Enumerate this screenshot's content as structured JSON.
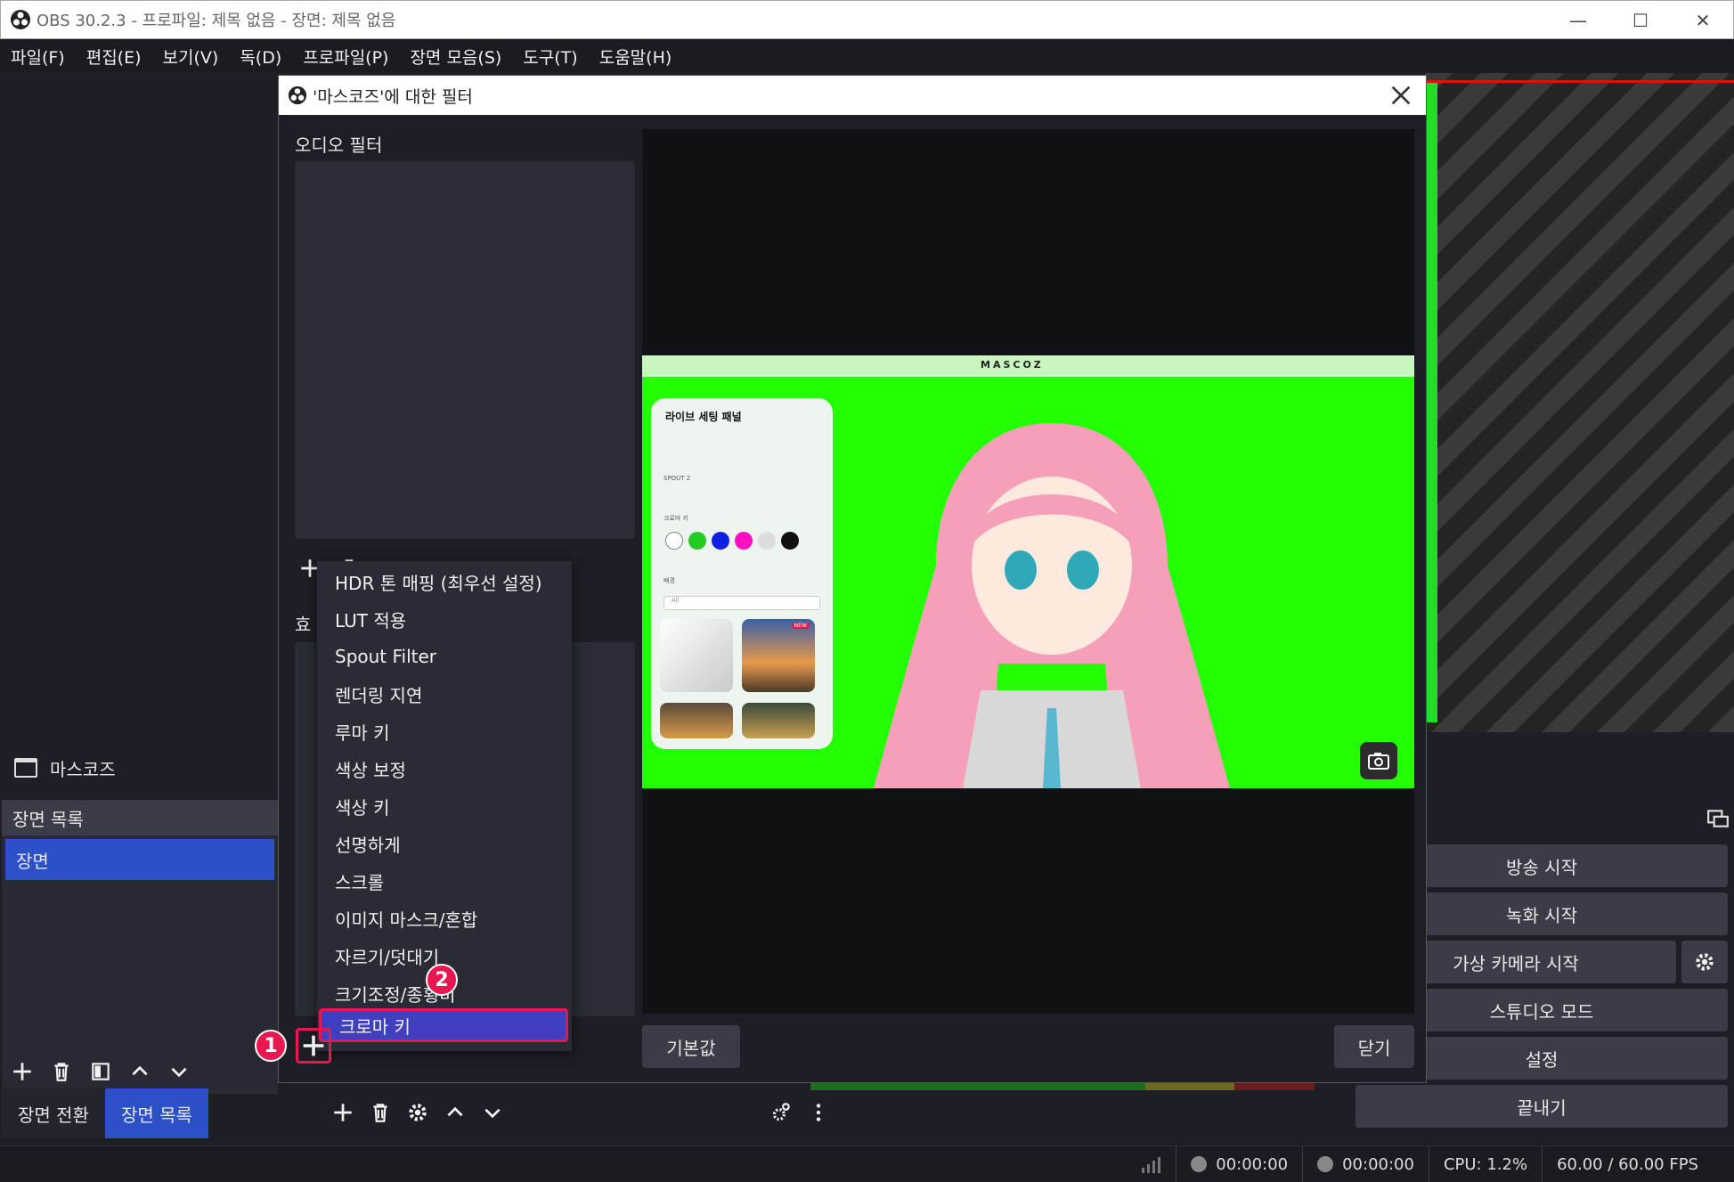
{
  "window": {
    "title": "OBS 30.2.3 - 프로파일: 제목 없음 - 장면: 제목 없음"
  },
  "menu": [
    "파일(F)",
    "편집(E)",
    "보기(V)",
    "독(D)",
    "프로파일(P)",
    "장면 모음(S)",
    "도구(T)",
    "도움말(H)"
  ],
  "source_name": "마스코즈",
  "scenes_dock": {
    "header": "장면 목록",
    "items": [
      "장면"
    ]
  },
  "dock_tabs": [
    "장면 전환",
    "장면 목록"
  ],
  "controls": {
    "start_stream": "방송 시작",
    "start_record": "녹화 시작",
    "virtual_camera": "가상 카메라 시작",
    "studio_mode": "스튜디오 모드",
    "settings": "설정",
    "exit": "끝내기"
  },
  "status": {
    "stream_time": "00:00:00",
    "record_time": "00:00:00",
    "cpu": "CPU: 1.2%",
    "fps": "60.00 / 60.00 FPS"
  },
  "dialog": {
    "title": "'마스코즈'에 대한 필터",
    "audio_filters_label": "오디오 필터",
    "effect_filters_label_partial": "효",
    "reset_button": "기본값",
    "close_button": "닫기"
  },
  "capture": {
    "brand": "MASCOZ",
    "panel_title": "라이브 세팅 패널",
    "spout_label": "SPOUT 2",
    "chroma_label": "크로마 키",
    "bg_label": "배경",
    "bg_select": "All",
    "new_badge": "NEW",
    "chroma_colors": [
      "#22cc22",
      "#1020e0",
      "#ff10c0"
    ]
  },
  "dropdown": {
    "items": [
      "HDR 톤 매핑 (최우선 설정)",
      "LUT 적용",
      "Spout Filter",
      "렌더링 지연",
      "루마 키",
      "색상 보정",
      "색상 키",
      "선명하게",
      "스크롤",
      "이미지 마스크/혼합",
      "자르기/덧대기",
      "크기조정/종횡비",
      "크로마 키"
    ],
    "selected": "크로마 키"
  },
  "annotations": [
    "1",
    "2"
  ],
  "colors": {
    "accent": "#2b50c8",
    "highlight": "#e8174f",
    "chroma_green": "#22ff00"
  }
}
